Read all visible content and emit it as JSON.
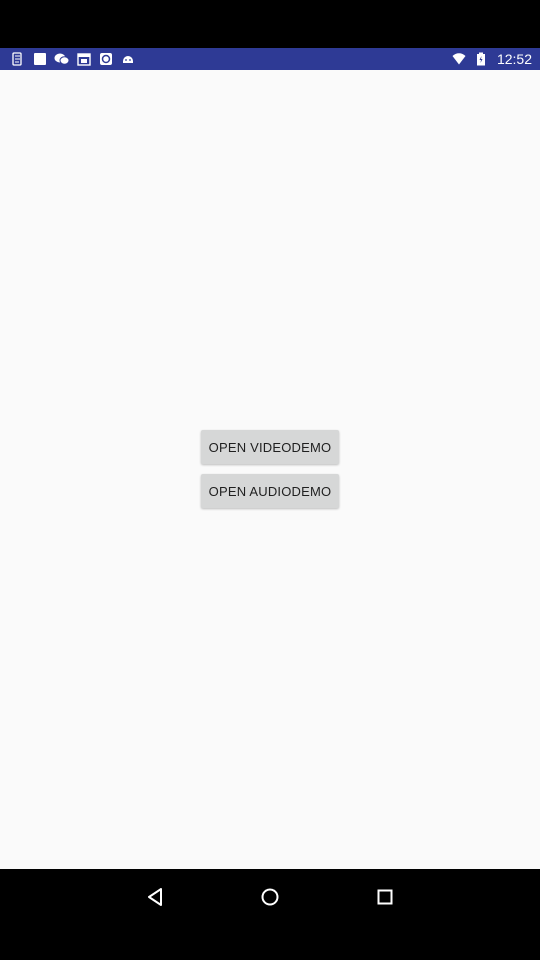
{
  "status_bar": {
    "time": "12:52",
    "background": "#2e3a95",
    "left_icons": [
      "app-notification-icon",
      "blank-notification-icon",
      "wechat-icon",
      "calendar-icon",
      "browser-icon",
      "android-debug-icon"
    ],
    "right_icons": [
      "wifi-icon",
      "battery-icon"
    ]
  },
  "main": {
    "background": "#fafafa",
    "buttons": [
      {
        "label": "OPEN VIDEODEMO"
      },
      {
        "label": "OPEN AUDIODEMO"
      }
    ],
    "button_color": "#d6d7d7"
  },
  "nav_bar": {
    "icons": [
      "back-icon",
      "home-icon",
      "recents-icon"
    ]
  }
}
